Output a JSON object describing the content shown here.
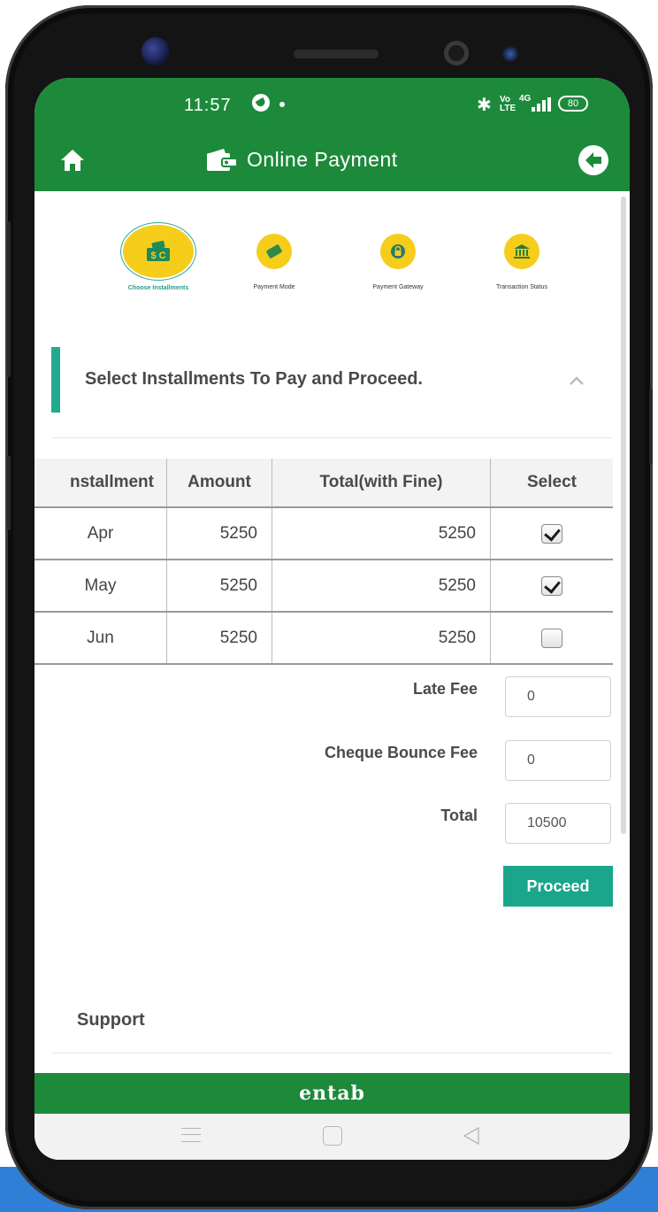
{
  "status_bar": {
    "time": "11:57",
    "volte": "Vo LTE",
    "signal": "4G",
    "battery": "80"
  },
  "header": {
    "title": "Online Payment",
    "icons": [
      "home-icon",
      "wallet-icon",
      "back-arrow-icon"
    ]
  },
  "steps": [
    {
      "label": "Choose Installments",
      "icon": "money-icon",
      "active": true
    },
    {
      "label": "Payment Mode",
      "icon": "card-icon",
      "active": false
    },
    {
      "label": "Payment Gateway",
      "icon": "lock-icon",
      "active": false
    },
    {
      "label": "Transaction Status",
      "icon": "bank-icon",
      "active": false
    }
  ],
  "section": {
    "title": "Select Installments To Pay and Proceed."
  },
  "table": {
    "headers": [
      "nstallment",
      "Amount",
      "Total(with Fine)",
      "Select"
    ],
    "rows": [
      {
        "installment": "Apr",
        "amount": "5250",
        "total": "5250",
        "selected": true
      },
      {
        "installment": "May",
        "amount": "5250",
        "total": "5250",
        "selected": true
      },
      {
        "installment": "Jun",
        "amount": "5250",
        "total": "5250",
        "selected": false
      }
    ]
  },
  "fees": {
    "late_fee_label": "Late Fee",
    "late_fee_value": "0",
    "cheque_bounce_label": "Cheque Bounce Fee",
    "cheque_bounce_value": "0",
    "total_label": "Total",
    "total_value": "10500"
  },
  "actions": {
    "proceed_label": "Proceed"
  },
  "support_label": "Support",
  "footer_brand": "entab",
  "colors": {
    "header_green": "#1d8a3b",
    "accent_teal": "#1aa68a",
    "step_yellow": "#f6cd1b"
  }
}
